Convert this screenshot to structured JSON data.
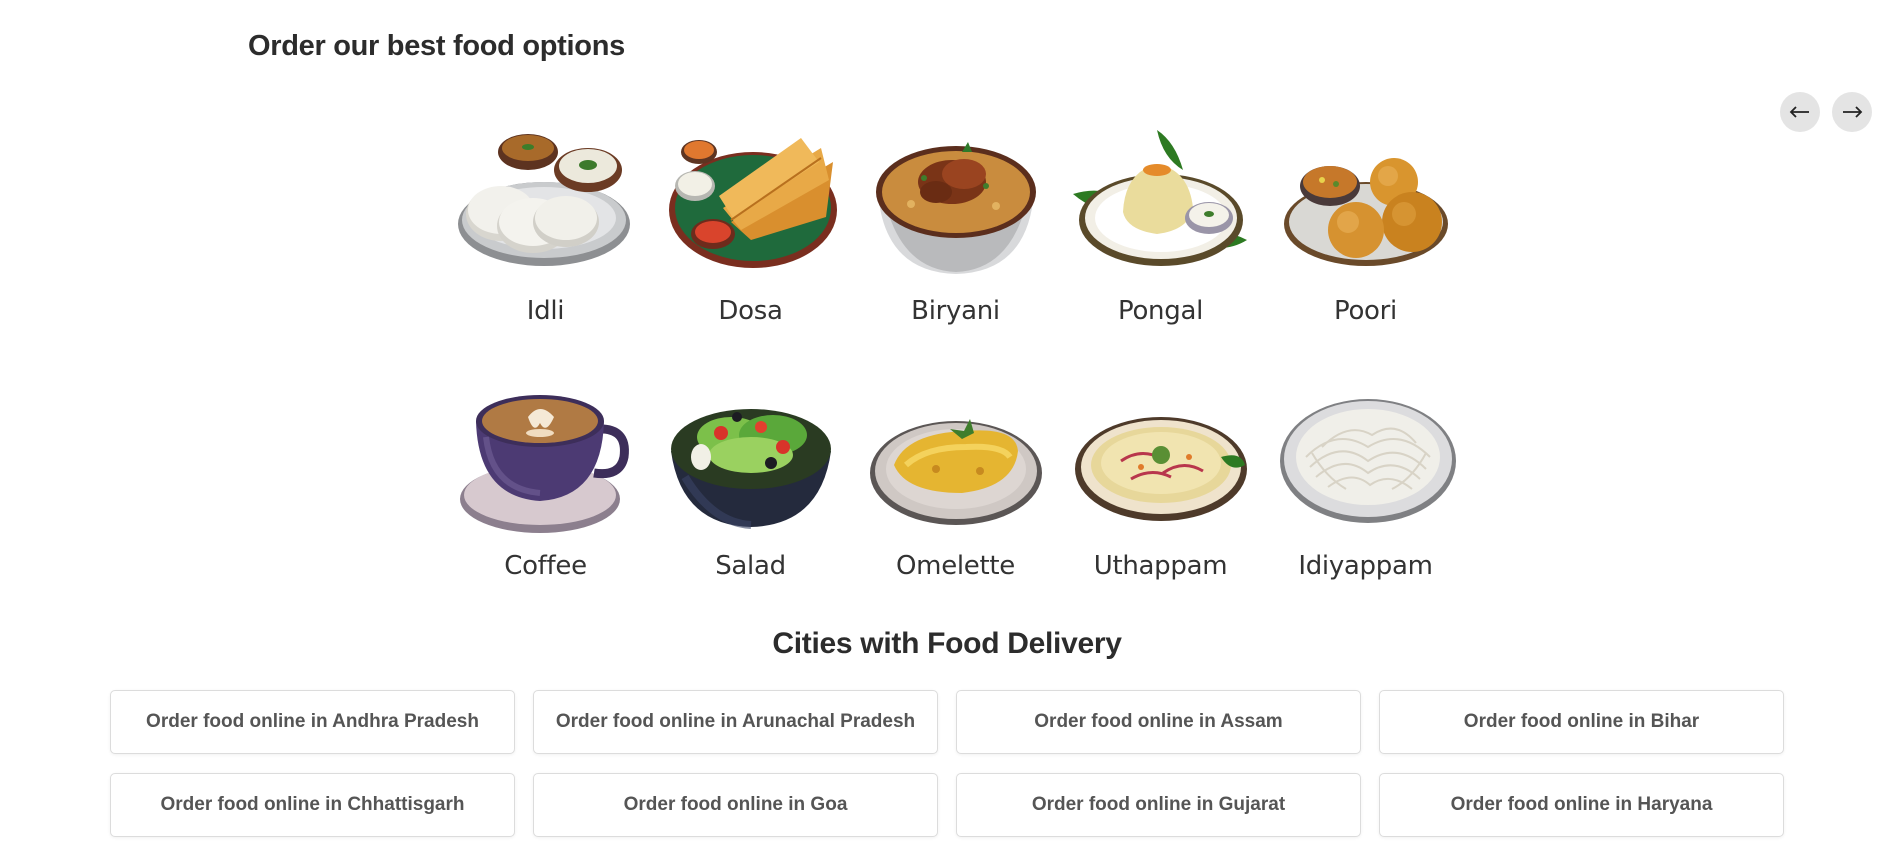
{
  "food_section": {
    "title": "Order our best food options",
    "prev_icon": "arrow-left-icon",
    "next_icon": "arrow-right-icon",
    "items": [
      {
        "label": "Idli",
        "icon": "idli-image"
      },
      {
        "label": "Dosa",
        "icon": "dosa-image"
      },
      {
        "label": "Biryani",
        "icon": "biryani-image"
      },
      {
        "label": "Pongal",
        "icon": "pongal-image"
      },
      {
        "label": "Poori",
        "icon": "poori-image"
      },
      {
        "label": "Coffee",
        "icon": "coffee-image"
      },
      {
        "label": "Salad",
        "icon": "salad-image"
      },
      {
        "label": "Omelette",
        "icon": "omelette-image"
      },
      {
        "label": "Uthappam",
        "icon": "uthappam-image"
      },
      {
        "label": "Idiyappam",
        "icon": "idiyappam-image"
      }
    ]
  },
  "cities_section": {
    "title": "Cities with Food Delivery",
    "links": [
      "Order food online in Andhra Pradesh",
      "Order food online in Arunachal Pradesh",
      "Order food online in Assam",
      "Order food online in Bihar",
      "Order food online in Chhattisgarh",
      "Order food online in Goa",
      "Order food online in Gujarat",
      "Order food online in Haryana"
    ]
  },
  "colors": {
    "text_dark": "#2c2c2c",
    "link_text": "#555555",
    "nav_button_bg": "#e4e4e4",
    "card_border": "#dcdcdc"
  }
}
